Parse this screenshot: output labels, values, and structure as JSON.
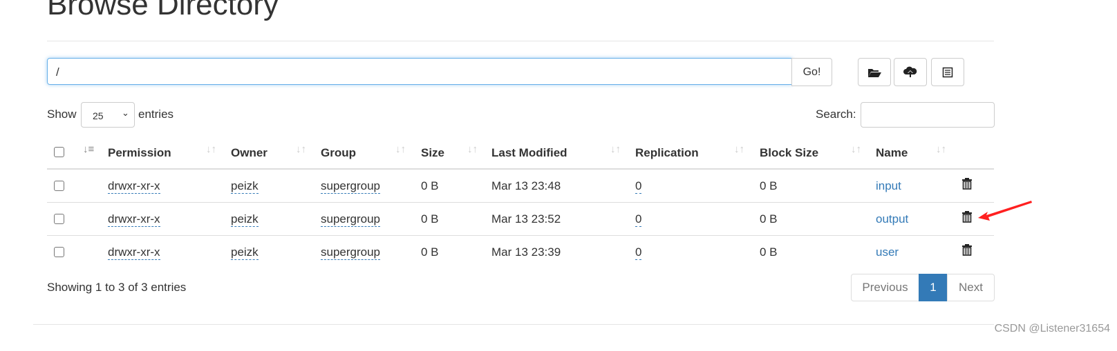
{
  "page_title": "Browse Directory",
  "path_input": {
    "value": "/",
    "go_label": "Go!"
  },
  "toolbar": {
    "icons": [
      "folder-open-icon",
      "cloud-upload-icon",
      "list-icon"
    ]
  },
  "length": {
    "show": "Show",
    "value": "25",
    "entries": "entries"
  },
  "search": {
    "label": "Search:",
    "value": ""
  },
  "columns": [
    "Permission",
    "Owner",
    "Group",
    "Size",
    "Last Modified",
    "Replication",
    "Block Size",
    "Name"
  ],
  "rows": [
    {
      "permission": "drwxr-xr-x",
      "owner": "peizk",
      "group": "supergroup",
      "size": "0 B",
      "modified": "Mar 13 23:48",
      "replication": "0",
      "block_size": "0 B",
      "name": "input"
    },
    {
      "permission": "drwxr-xr-x",
      "owner": "peizk",
      "group": "supergroup",
      "size": "0 B",
      "modified": "Mar 13 23:52",
      "replication": "0",
      "block_size": "0 B",
      "name": "output"
    },
    {
      "permission": "drwxr-xr-x",
      "owner": "peizk",
      "group": "supergroup",
      "size": "0 B",
      "modified": "Mar 13 23:39",
      "replication": "0",
      "block_size": "0 B",
      "name": "user"
    }
  ],
  "footer": {
    "info": "Showing 1 to 3 of 3 entries",
    "previous": "Previous",
    "page": "1",
    "next": "Next"
  },
  "watermark": "CSDN @Listener31654",
  "colors": {
    "link": "#337ab7",
    "active_page": "#337ab7",
    "annotation_arrow": "#ff2020"
  }
}
